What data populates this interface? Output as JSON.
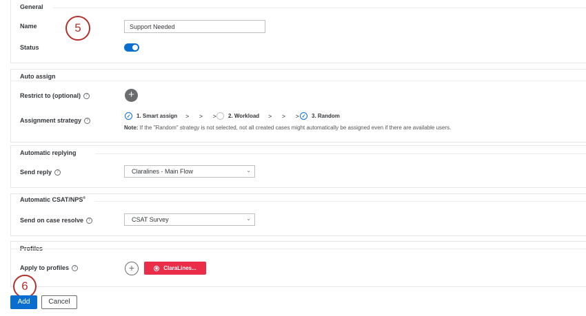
{
  "general": {
    "title": "General",
    "name_label": "Name",
    "name_value": "Support Needed",
    "status_label": "Status",
    "status_on": true
  },
  "auto_assign": {
    "title": "Auto assign",
    "restrict_label": "Restrict to (optional)",
    "strategy_label": "Assignment strategy",
    "steps": [
      {
        "label": "1. Smart assign",
        "selected": true
      },
      {
        "label": "2. Workload",
        "selected": false
      },
      {
        "label": "3. Random",
        "selected": true
      }
    ],
    "arrows": "> > >",
    "note_prefix": "Note:",
    "note_text": " If the \"Random\" strategy is not selected, not all created cases might automatically be assigned even if there are available users."
  },
  "auto_reply": {
    "title": "Automatic replying",
    "send_reply_label": "Send reply",
    "send_reply_value": "Claralines - Main Flow"
  },
  "csat": {
    "title": "Automatic CSAT/NPS",
    "title_mark": "®",
    "resolve_label": "Send on case resolve",
    "resolve_value": "CSAT Survey"
  },
  "profiles": {
    "title": "Profiles",
    "apply_label": "Apply to profiles",
    "chip_label": "ClaraLines..."
  },
  "footer": {
    "add_label": "Add",
    "cancel_label": "Cancel"
  },
  "callouts": {
    "five": "5",
    "six": "6"
  },
  "colors": {
    "accent": "#0a6ed1",
    "chip": "#ea2e4a",
    "callout": "#b2302a"
  }
}
